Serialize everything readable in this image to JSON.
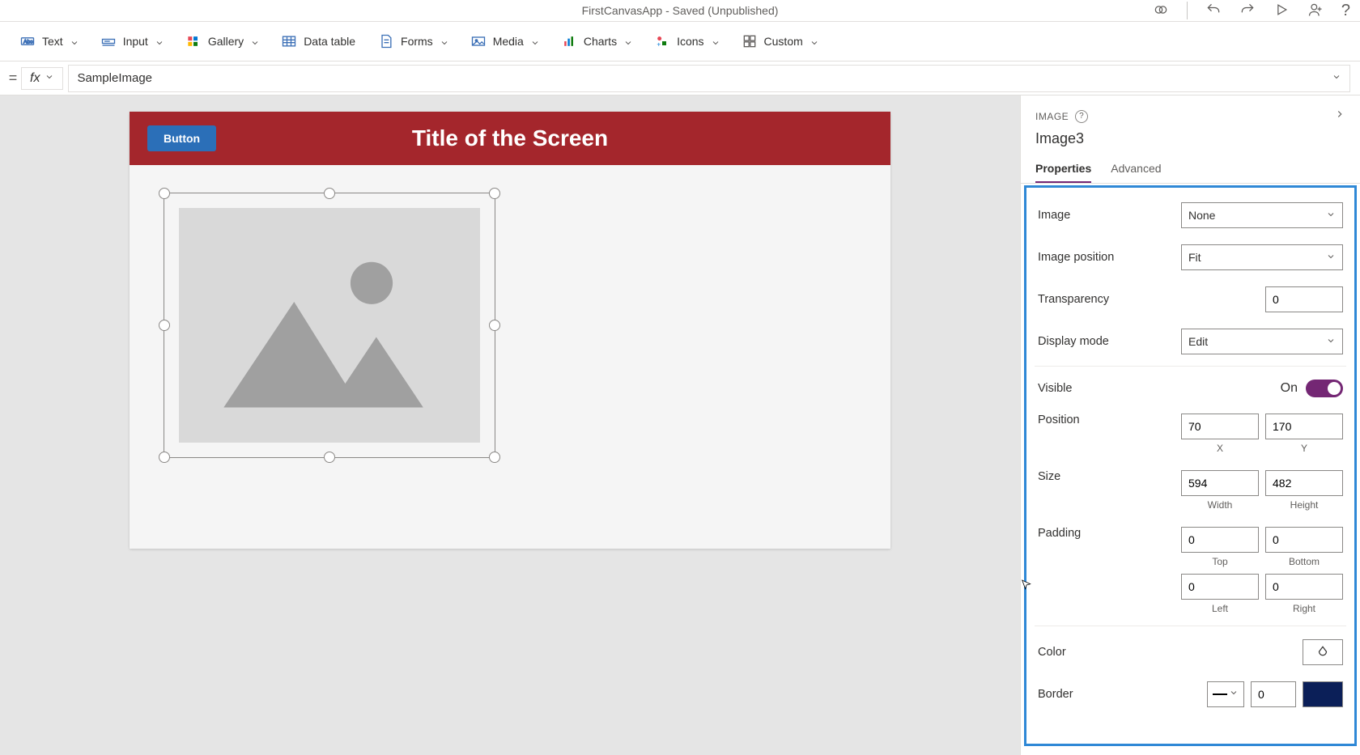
{
  "titlebar": {
    "center": "FirstCanvasApp - Saved (Unpublished)"
  },
  "ribbon": {
    "text": "Text",
    "input": "Input",
    "gallery": "Gallery",
    "datatable": "Data table",
    "forms": "Forms",
    "media": "Media",
    "charts": "Charts",
    "icons": "Icons",
    "custom": "Custom"
  },
  "formula": {
    "value": "SampleImage"
  },
  "canvas": {
    "button_label": "Button",
    "title": "Title of the Screen"
  },
  "props": {
    "heading": "IMAGE",
    "control_name": "Image3",
    "tabs": {
      "properties": "Properties",
      "advanced": "Advanced"
    },
    "rows": {
      "image": {
        "label": "Image",
        "value": "None"
      },
      "image_position": {
        "label": "Image position",
        "value": "Fit"
      },
      "transparency": {
        "label": "Transparency",
        "value": "0"
      },
      "display_mode": {
        "label": "Display mode",
        "value": "Edit"
      },
      "visible": {
        "label": "Visible",
        "state": "On"
      },
      "position": {
        "label": "Position",
        "x": "70",
        "y": "170",
        "xlabel": "X",
        "ylabel": "Y"
      },
      "size": {
        "label": "Size",
        "w": "594",
        "h": "482",
        "wlabel": "Width",
        "hlabel": "Height"
      },
      "padding": {
        "label": "Padding",
        "top": "0",
        "bottom": "0",
        "left": "0",
        "right": "0",
        "tlabel": "Top",
        "blabel": "Bottom",
        "llabel": "Left",
        "rlabel": "Right"
      },
      "color": {
        "label": "Color"
      },
      "border": {
        "label": "Border",
        "value": "0",
        "swatch": "#0b1f58"
      }
    }
  }
}
